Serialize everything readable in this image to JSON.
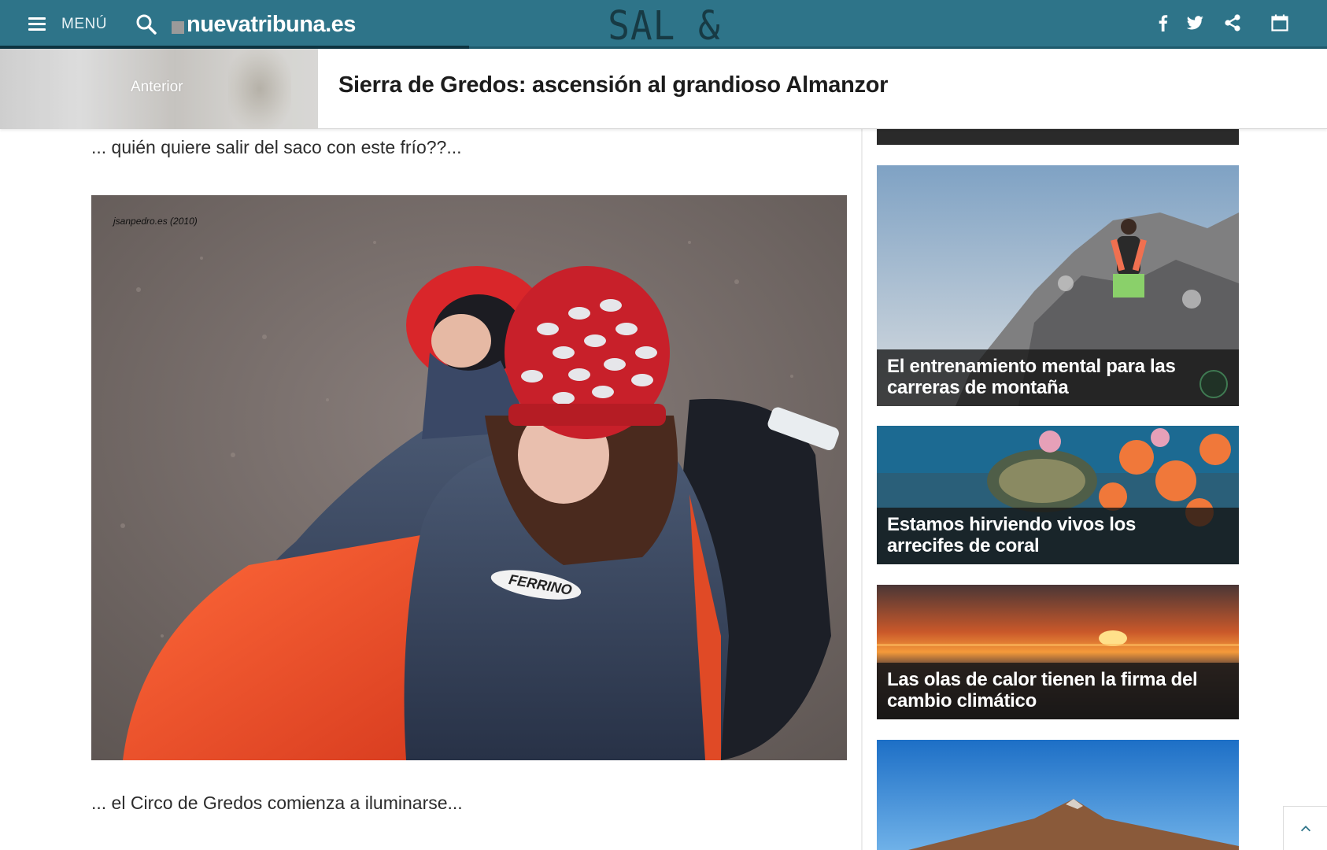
{
  "header": {
    "menu_label": "MENÚ",
    "site_name": "nuevatribuna.es",
    "section_name": "SAL & ROCA",
    "bar_color": "#2e7489",
    "icons": [
      "menu-icon",
      "search-icon",
      "facebook-icon",
      "twitter-icon",
      "share-icon",
      "calendar-icon"
    ]
  },
  "article_bar": {
    "prev_label": "Anterior",
    "title": "Sierra de Gredos: ascensión al grandioso Almanzor"
  },
  "content": {
    "caption_top": "... quién quiere salir del saco con este frío??...",
    "photo_watermark": "jsanpedro.es (2010)",
    "photo_brand": "FERRINO",
    "caption_bottom": "... el Circo de Gredos comienza a iluminarse..."
  },
  "sidebar": {
    "cards": [
      {
        "title": "El entrenamiento mental para las carreras de montaña"
      },
      {
        "title": "Estamos hirviendo vivos los arrecifes de coral"
      },
      {
        "title": "Las olas de calor tienen la firma del cambio climático"
      }
    ]
  }
}
